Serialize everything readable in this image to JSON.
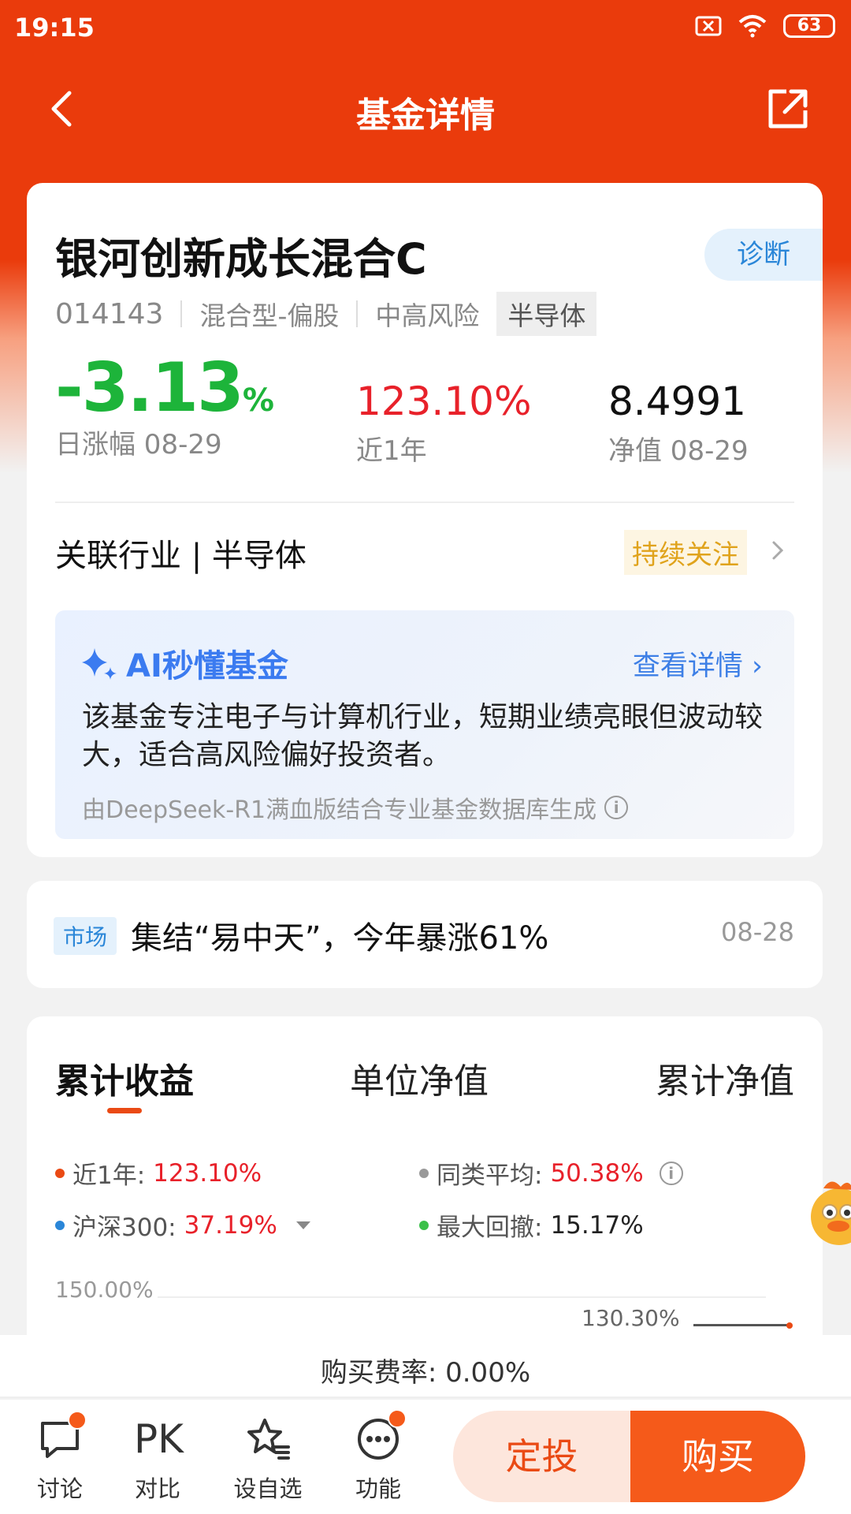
{
  "status": {
    "time": "19:15",
    "battery": "63"
  },
  "header": {
    "title": "基金详情"
  },
  "fund": {
    "name": "银河创新成长混合C",
    "diagnose": "诊断",
    "code": "014143",
    "type": "混合型-偏股",
    "risk": "中高风险",
    "sector_tag": "半导体",
    "daily_change": "-3.13",
    "daily_change_unit": "%",
    "daily_label": "日涨幅 08-29",
    "year_return": "123.10%",
    "year_label": "近1年",
    "nav": "8.4991",
    "nav_label": "净值 08-29",
    "industry": "关联行业 | 半导体",
    "follow": "持续关注"
  },
  "ai": {
    "title": "AI秒懂基金",
    "more": "查看详情",
    "body": "该基金专注电子与计算机行业，短期业绩亮眼但波动较大，适合高风险偏好投资者。",
    "source": "由DeepSeek-R1满血版结合专业基金数据库生成"
  },
  "news": {
    "tag": "市场",
    "title": "集结“易中天”，今年暴涨61%",
    "date": "08-28"
  },
  "chart": {
    "tabs": [
      "累计收益",
      "单位净值",
      "累计净值"
    ],
    "legend": [
      {
        "label": "近1年:",
        "value": "123.10%",
        "color": "#ea4a14"
      },
      {
        "label": "同类平均:",
        "value": "50.38%",
        "color": "#999999"
      },
      {
        "label": "沪深300:",
        "value": "37.19%",
        "color": "#2a86d8"
      },
      {
        "label": "最大回撤:",
        "value": "15.17%",
        "color": "#3cc04a"
      }
    ],
    "y_tick_top": "150.00%",
    "callout": "130.30%"
  },
  "fee": "购买费率: 0.00%",
  "bottom_nav": [
    {
      "label": "讨论",
      "icon": "chat-bubble-icon"
    },
    {
      "label": "对比",
      "icon": "pk-icon",
      "icon_text": "PK"
    },
    {
      "label": "设自选",
      "icon": "star-list-icon"
    },
    {
      "label": "功能",
      "icon": "more-dots-icon"
    }
  ],
  "actions": {
    "sip": "定投",
    "buy": "购买"
  }
}
